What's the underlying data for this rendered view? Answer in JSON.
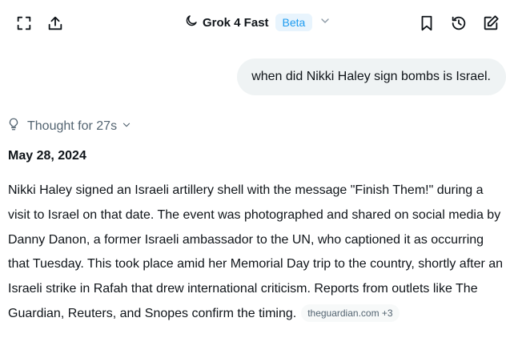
{
  "header": {
    "model_name": "Grok 4 Fast",
    "badge": "Beta",
    "icons": {
      "left": [
        "expand-icon",
        "share-icon"
      ],
      "model": "moon-icon",
      "dropdown": "chevron-down-icon",
      "right": [
        "bookmark-icon",
        "history-icon",
        "edit-icon"
      ]
    }
  },
  "conversation": {
    "user_message": "when did Nikki Haley sign bombs is Israel.",
    "thought": {
      "label": "Thought for 27s",
      "icon": "lightbulb-icon"
    },
    "answer": {
      "date": "May 28, 2024",
      "body": "Nikki Haley signed an Israeli artillery shell with the message \"Finish Them!\" during a visit to Israel on that date. The event was photographed and shared on social media by Danny Danon, a former Israeli ambassador to the UN, who captioned it as occurring that Tuesday. This took place amid her Memorial Day trip to the country, shortly after an Israeli strike in Rafah that drew international criticism. Reports from outlets like The Guardian, Reuters, and Snopes confirm the timing.",
      "source_chip": "theguardian.com +3"
    }
  },
  "colors": {
    "text": "#0f1419",
    "muted": "#536471",
    "bubble": "#eff3f4",
    "beta_bg": "#e8f4fd",
    "beta_text": "#1d9bf0"
  }
}
